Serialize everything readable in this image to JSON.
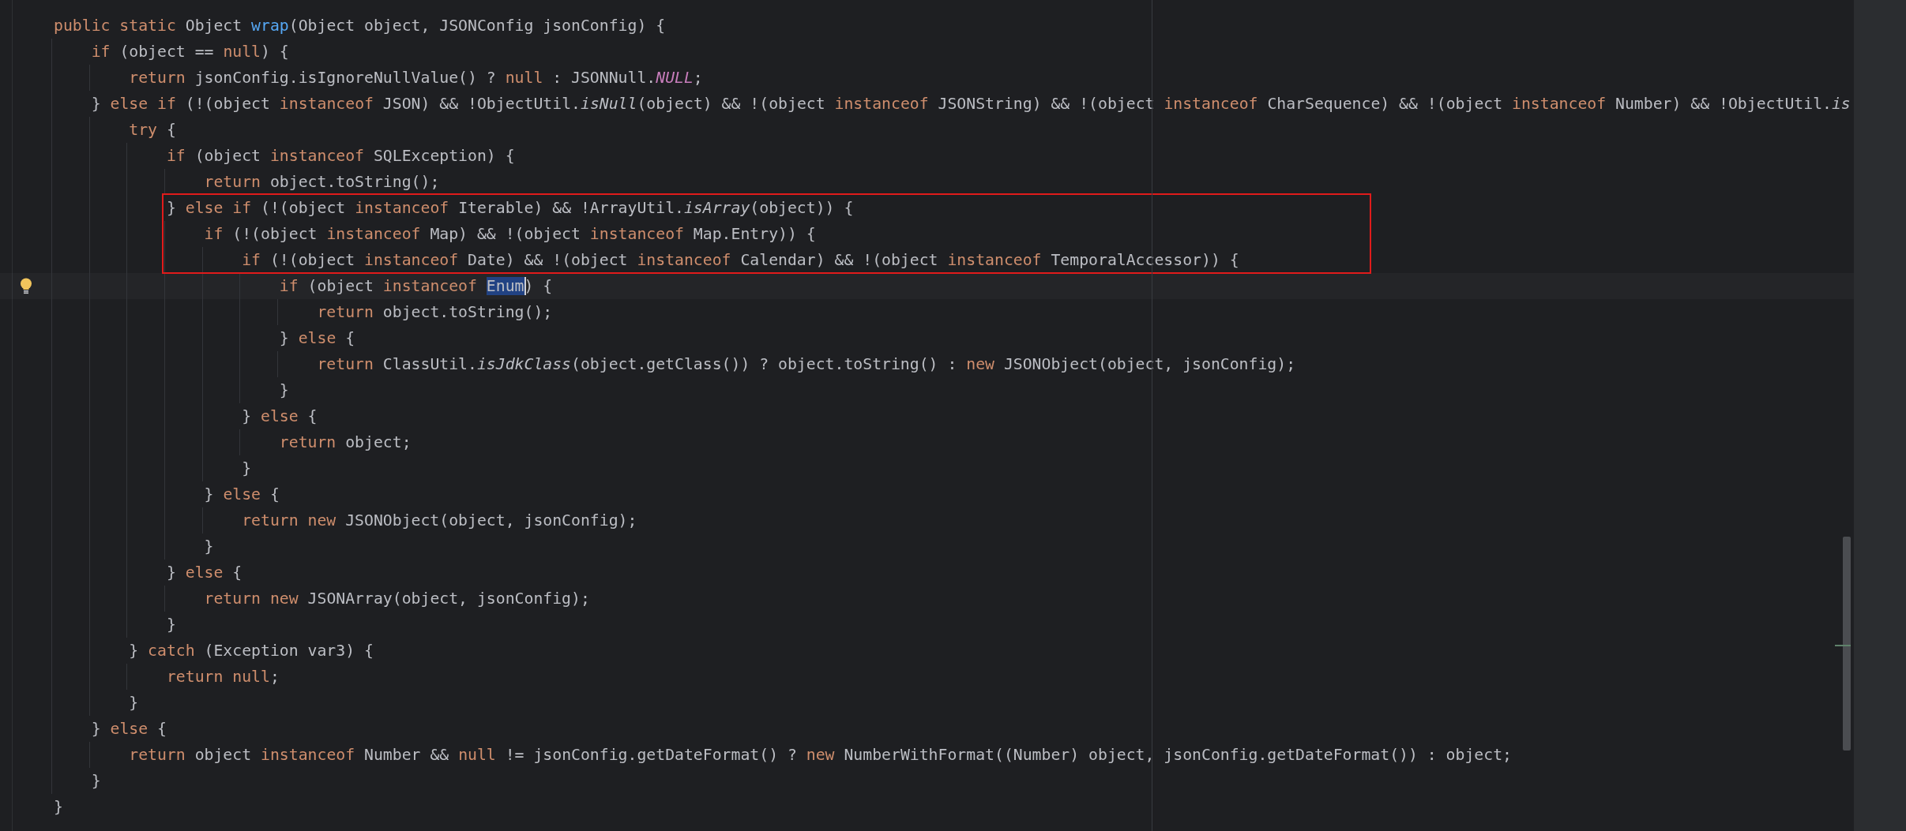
{
  "editor": {
    "lines": [
      {
        "current": false,
        "boxed": false,
        "tokens": [
          {
            "text": "public static ",
            "kind": "keyword"
          },
          {
            "text": "Object ",
            "kind": "plain"
          },
          {
            "text": "wrap",
            "kind": "method"
          },
          {
            "text": "(Object object, JSONConfig jsonConfig) {",
            "kind": "plain"
          }
        ]
      },
      {
        "current": false,
        "boxed": false,
        "tokens": [
          {
            "text": "    if",
            "kind": "keyword"
          },
          {
            "text": " (object == ",
            "kind": "plain"
          },
          {
            "text": "null",
            "kind": "keyword"
          },
          {
            "text": ") {",
            "kind": "plain"
          }
        ]
      },
      {
        "current": false,
        "boxed": false,
        "tokens": [
          {
            "text": "        return",
            "kind": "keyword"
          },
          {
            "text": " jsonConfig.isIgnoreNullValue() ? ",
            "kind": "plain"
          },
          {
            "text": "null",
            "kind": "keyword"
          },
          {
            "text": " : JSONNull.",
            "kind": "plain"
          },
          {
            "text": "NULL",
            "kind": "constant"
          },
          {
            "text": ";",
            "kind": "plain"
          }
        ]
      },
      {
        "current": false,
        "boxed": false,
        "tokens": [
          {
            "text": "    } ",
            "kind": "plain"
          },
          {
            "text": "else if",
            "kind": "keyword"
          },
          {
            "text": " (!(object ",
            "kind": "plain"
          },
          {
            "text": "instanceof",
            "kind": "keyword"
          },
          {
            "text": " JSON) && !ObjectUtil.",
            "kind": "plain"
          },
          {
            "text": "isNull",
            "kind": "static"
          },
          {
            "text": "(object) && !(object ",
            "kind": "plain"
          },
          {
            "text": "instanceof",
            "kind": "keyword"
          },
          {
            "text": " JSONString) && !(object ",
            "kind": "plain"
          },
          {
            "text": "instanceof",
            "kind": "keyword"
          },
          {
            "text": " CharSequence) && !(object ",
            "kind": "plain"
          },
          {
            "text": "instanceof",
            "kind": "keyword"
          },
          {
            "text": " Number) && !ObjectUtil.",
            "kind": "plain"
          },
          {
            "text": "is",
            "kind": "static"
          }
        ]
      },
      {
        "current": false,
        "boxed": false,
        "tokens": [
          {
            "text": "        try",
            "kind": "keyword"
          },
          {
            "text": " {",
            "kind": "plain"
          }
        ]
      },
      {
        "current": false,
        "boxed": false,
        "tokens": [
          {
            "text": "            if",
            "kind": "keyword"
          },
          {
            "text": " (object ",
            "kind": "plain"
          },
          {
            "text": "instanceof",
            "kind": "keyword"
          },
          {
            "text": " SQLException) {",
            "kind": "plain"
          }
        ]
      },
      {
        "current": false,
        "boxed": false,
        "tokens": [
          {
            "text": "                return",
            "kind": "keyword"
          },
          {
            "text": " object.toString();",
            "kind": "plain"
          }
        ]
      },
      {
        "current": false,
        "boxed": true,
        "tokens": [
          {
            "text": "            } ",
            "kind": "plain"
          },
          {
            "text": "else if",
            "kind": "keyword"
          },
          {
            "text": " (!(object ",
            "kind": "plain"
          },
          {
            "text": "instanceof",
            "kind": "keyword"
          },
          {
            "text": " Iterable) && !ArrayUtil.",
            "kind": "plain"
          },
          {
            "text": "isArray",
            "kind": "static"
          },
          {
            "text": "(object)) {",
            "kind": "plain"
          }
        ]
      },
      {
        "current": false,
        "boxed": true,
        "tokens": [
          {
            "text": "                if",
            "kind": "keyword"
          },
          {
            "text": " (!(object ",
            "kind": "plain"
          },
          {
            "text": "instanceof",
            "kind": "keyword"
          },
          {
            "text": " Map) && !(object ",
            "kind": "plain"
          },
          {
            "text": "instanceof",
            "kind": "keyword"
          },
          {
            "text": " Map.Entry)) {",
            "kind": "plain"
          }
        ]
      },
      {
        "current": false,
        "boxed": true,
        "tokens": [
          {
            "text": "                    if",
            "kind": "keyword"
          },
          {
            "text": " (!(object ",
            "kind": "plain"
          },
          {
            "text": "instanceof",
            "kind": "keyword"
          },
          {
            "text": " Date) && !(object ",
            "kind": "plain"
          },
          {
            "text": "instanceof",
            "kind": "keyword"
          },
          {
            "text": " Calendar) && !(object ",
            "kind": "plain"
          },
          {
            "text": "instanceof",
            "kind": "keyword"
          },
          {
            "text": " TemporalAccessor)) {",
            "kind": "plain"
          }
        ]
      },
      {
        "current": true,
        "boxed": false,
        "tokens": [
          {
            "text": "                        if",
            "kind": "keyword"
          },
          {
            "text": " (object ",
            "kind": "plain"
          },
          {
            "text": "instanceof ",
            "kind": "keyword"
          },
          {
            "text": "Enum",
            "kind": "selected"
          },
          {
            "text": ") {",
            "kind": "plain"
          }
        ]
      },
      {
        "current": false,
        "boxed": false,
        "tokens": [
          {
            "text": "                            return",
            "kind": "keyword"
          },
          {
            "text": " object.toString();",
            "kind": "plain"
          }
        ]
      },
      {
        "current": false,
        "boxed": false,
        "tokens": [
          {
            "text": "                        } ",
            "kind": "plain"
          },
          {
            "text": "else",
            "kind": "keyword"
          },
          {
            "text": " {",
            "kind": "plain"
          }
        ]
      },
      {
        "current": false,
        "boxed": false,
        "tokens": [
          {
            "text": "                            return",
            "kind": "keyword"
          },
          {
            "text": " ClassUtil.",
            "kind": "plain"
          },
          {
            "text": "isJdkClass",
            "kind": "static"
          },
          {
            "text": "(object.getClass()) ? object.toString() : ",
            "kind": "plain"
          },
          {
            "text": "new",
            "kind": "keyword"
          },
          {
            "text": " JSONObject(object, jsonConfig);",
            "kind": "plain"
          }
        ]
      },
      {
        "current": false,
        "boxed": false,
        "tokens": [
          {
            "text": "                        }",
            "kind": "plain"
          }
        ]
      },
      {
        "current": false,
        "boxed": false,
        "tokens": [
          {
            "text": "                    } ",
            "kind": "plain"
          },
          {
            "text": "else",
            "kind": "keyword"
          },
          {
            "text": " {",
            "kind": "plain"
          }
        ]
      },
      {
        "current": false,
        "boxed": false,
        "tokens": [
          {
            "text": "                        return",
            "kind": "keyword"
          },
          {
            "text": " object;",
            "kind": "plain"
          }
        ]
      },
      {
        "current": false,
        "boxed": false,
        "tokens": [
          {
            "text": "                    }",
            "kind": "plain"
          }
        ]
      },
      {
        "current": false,
        "boxed": false,
        "tokens": [
          {
            "text": "                } ",
            "kind": "plain"
          },
          {
            "text": "else",
            "kind": "keyword"
          },
          {
            "text": " {",
            "kind": "plain"
          }
        ]
      },
      {
        "current": false,
        "boxed": false,
        "tokens": [
          {
            "text": "                    return new",
            "kind": "keyword"
          },
          {
            "text": " JSONObject(object, jsonConfig);",
            "kind": "plain"
          }
        ]
      },
      {
        "current": false,
        "boxed": false,
        "tokens": [
          {
            "text": "                }",
            "kind": "plain"
          }
        ]
      },
      {
        "current": false,
        "boxed": false,
        "tokens": [
          {
            "text": "            } ",
            "kind": "plain"
          },
          {
            "text": "else",
            "kind": "keyword"
          },
          {
            "text": " {",
            "kind": "plain"
          }
        ]
      },
      {
        "current": false,
        "boxed": false,
        "tokens": [
          {
            "text": "                return new",
            "kind": "keyword"
          },
          {
            "text": " JSONArray(object, jsonConfig);",
            "kind": "plain"
          }
        ]
      },
      {
        "current": false,
        "boxed": false,
        "tokens": [
          {
            "text": "            }",
            "kind": "plain"
          }
        ]
      },
      {
        "current": false,
        "boxed": false,
        "tokens": [
          {
            "text": "        } ",
            "kind": "plain"
          },
          {
            "text": "catch",
            "kind": "keyword"
          },
          {
            "text": " (Exception var3) {",
            "kind": "plain"
          }
        ]
      },
      {
        "current": false,
        "boxed": false,
        "tokens": [
          {
            "text": "            return null",
            "kind": "keyword"
          },
          {
            "text": ";",
            "kind": "plain"
          }
        ]
      },
      {
        "current": false,
        "boxed": false,
        "tokens": [
          {
            "text": "        }",
            "kind": "plain"
          }
        ]
      },
      {
        "current": false,
        "boxed": false,
        "tokens": [
          {
            "text": "    } ",
            "kind": "plain"
          },
          {
            "text": "else",
            "kind": "keyword"
          },
          {
            "text": " {",
            "kind": "plain"
          }
        ]
      },
      {
        "current": false,
        "boxed": false,
        "tokens": [
          {
            "text": "        return",
            "kind": "keyword"
          },
          {
            "text": " object ",
            "kind": "plain"
          },
          {
            "text": "instanceof",
            "kind": "keyword"
          },
          {
            "text": " Number && ",
            "kind": "plain"
          },
          {
            "text": "null",
            "kind": "keyword"
          },
          {
            "text": " != jsonConfig.getDateFormat() ? ",
            "kind": "plain"
          },
          {
            "text": "new",
            "kind": "keyword"
          },
          {
            "text": " NumberWithFormat((Number) object, jsonConfig.getDateFormat()) : object;",
            "kind": "plain"
          }
        ]
      },
      {
        "current": false,
        "boxed": false,
        "tokens": [
          {
            "text": "    }",
            "kind": "plain"
          }
        ]
      },
      {
        "current": false,
        "boxed": false,
        "tokens": [
          {
            "text": "}",
            "kind": "plain"
          }
        ]
      }
    ]
  }
}
